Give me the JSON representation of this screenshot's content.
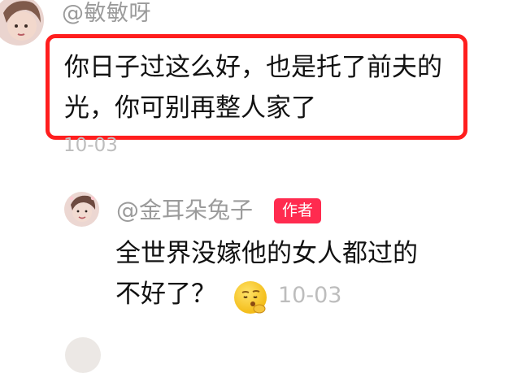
{
  "comment": {
    "username": "@敏敏呀",
    "text": "你日子过这么好，也是托了前夫的光，你可别再整人家了",
    "time": "10-03"
  },
  "reply": {
    "username": "@金耳朵兔子",
    "badge": "作者",
    "text_line1": "全世界没嫁他的女人都过的",
    "text_line2": "不好了？",
    "emoji": "thinking-face-emoji",
    "time": "10-03"
  },
  "colors": {
    "highlight_border": "#ff1e1e",
    "badge_bg": "#ff2b4f",
    "meta_text": "#9b9b9b",
    "time_text": "#bdbdbd"
  }
}
